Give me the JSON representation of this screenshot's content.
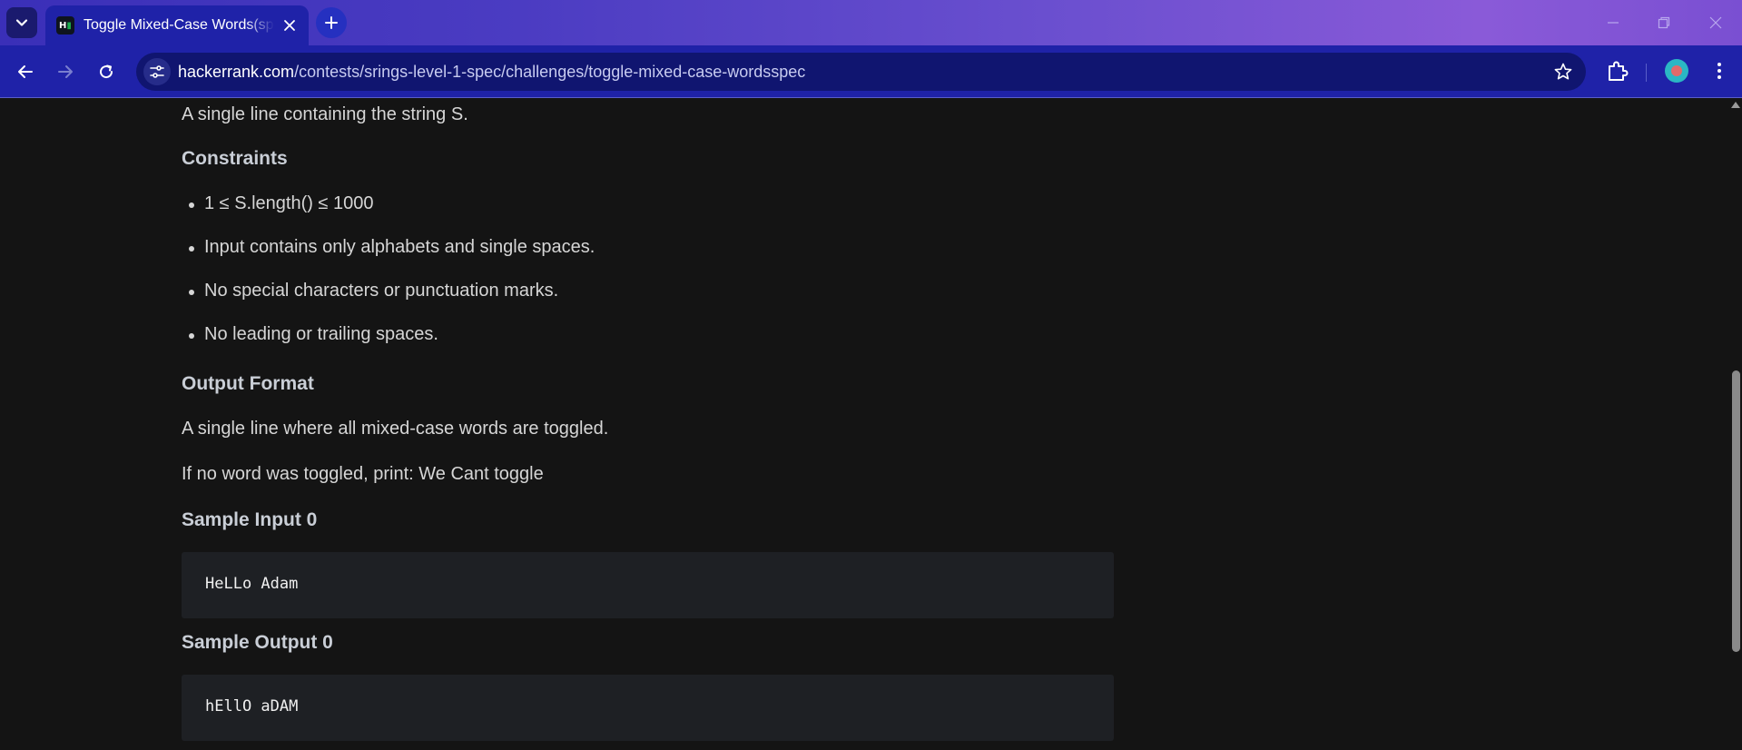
{
  "browser": {
    "tab_title": "Toggle Mixed-Case Words(spec)",
    "url_domain": "hackerrank.com",
    "url_path": "/contests/srings-level-1-spec/challenges/toggle-mixed-case-wordsspec",
    "favicon_text": "H",
    "icons": {
      "tab_search": "chevron-down-icon",
      "tab_close": "close-icon",
      "new_tab": "plus-icon",
      "back": "arrow-left-icon",
      "forward": "arrow-right-icon",
      "reload": "reload-icon",
      "site_info": "tune-icon",
      "bookmark": "star-icon",
      "extensions": "puzzle-icon",
      "profile": "avatar",
      "menu": "kebab-menu-icon"
    },
    "accent_color": "#1f22a8"
  },
  "problem": {
    "input_desc": "A single line containing the string S.",
    "constraints_heading": "Constraints",
    "constraints": [
      "1 ≤ S.length() ≤ 1000",
      "Input contains only alphabets and single spaces.",
      "No special characters or punctuation marks.",
      "No leading or trailing spaces."
    ],
    "output_heading": "Output Format",
    "output_desc_1": "A single line where all mixed-case words are toggled.",
    "output_desc_2": "If no word was toggled, print: We Cant toggle",
    "sample_input_heading": "Sample Input 0",
    "sample_input": "HeLLo Adam",
    "sample_output_heading": "Sample Output 0",
    "sample_output": "hEllO aDAM"
  }
}
